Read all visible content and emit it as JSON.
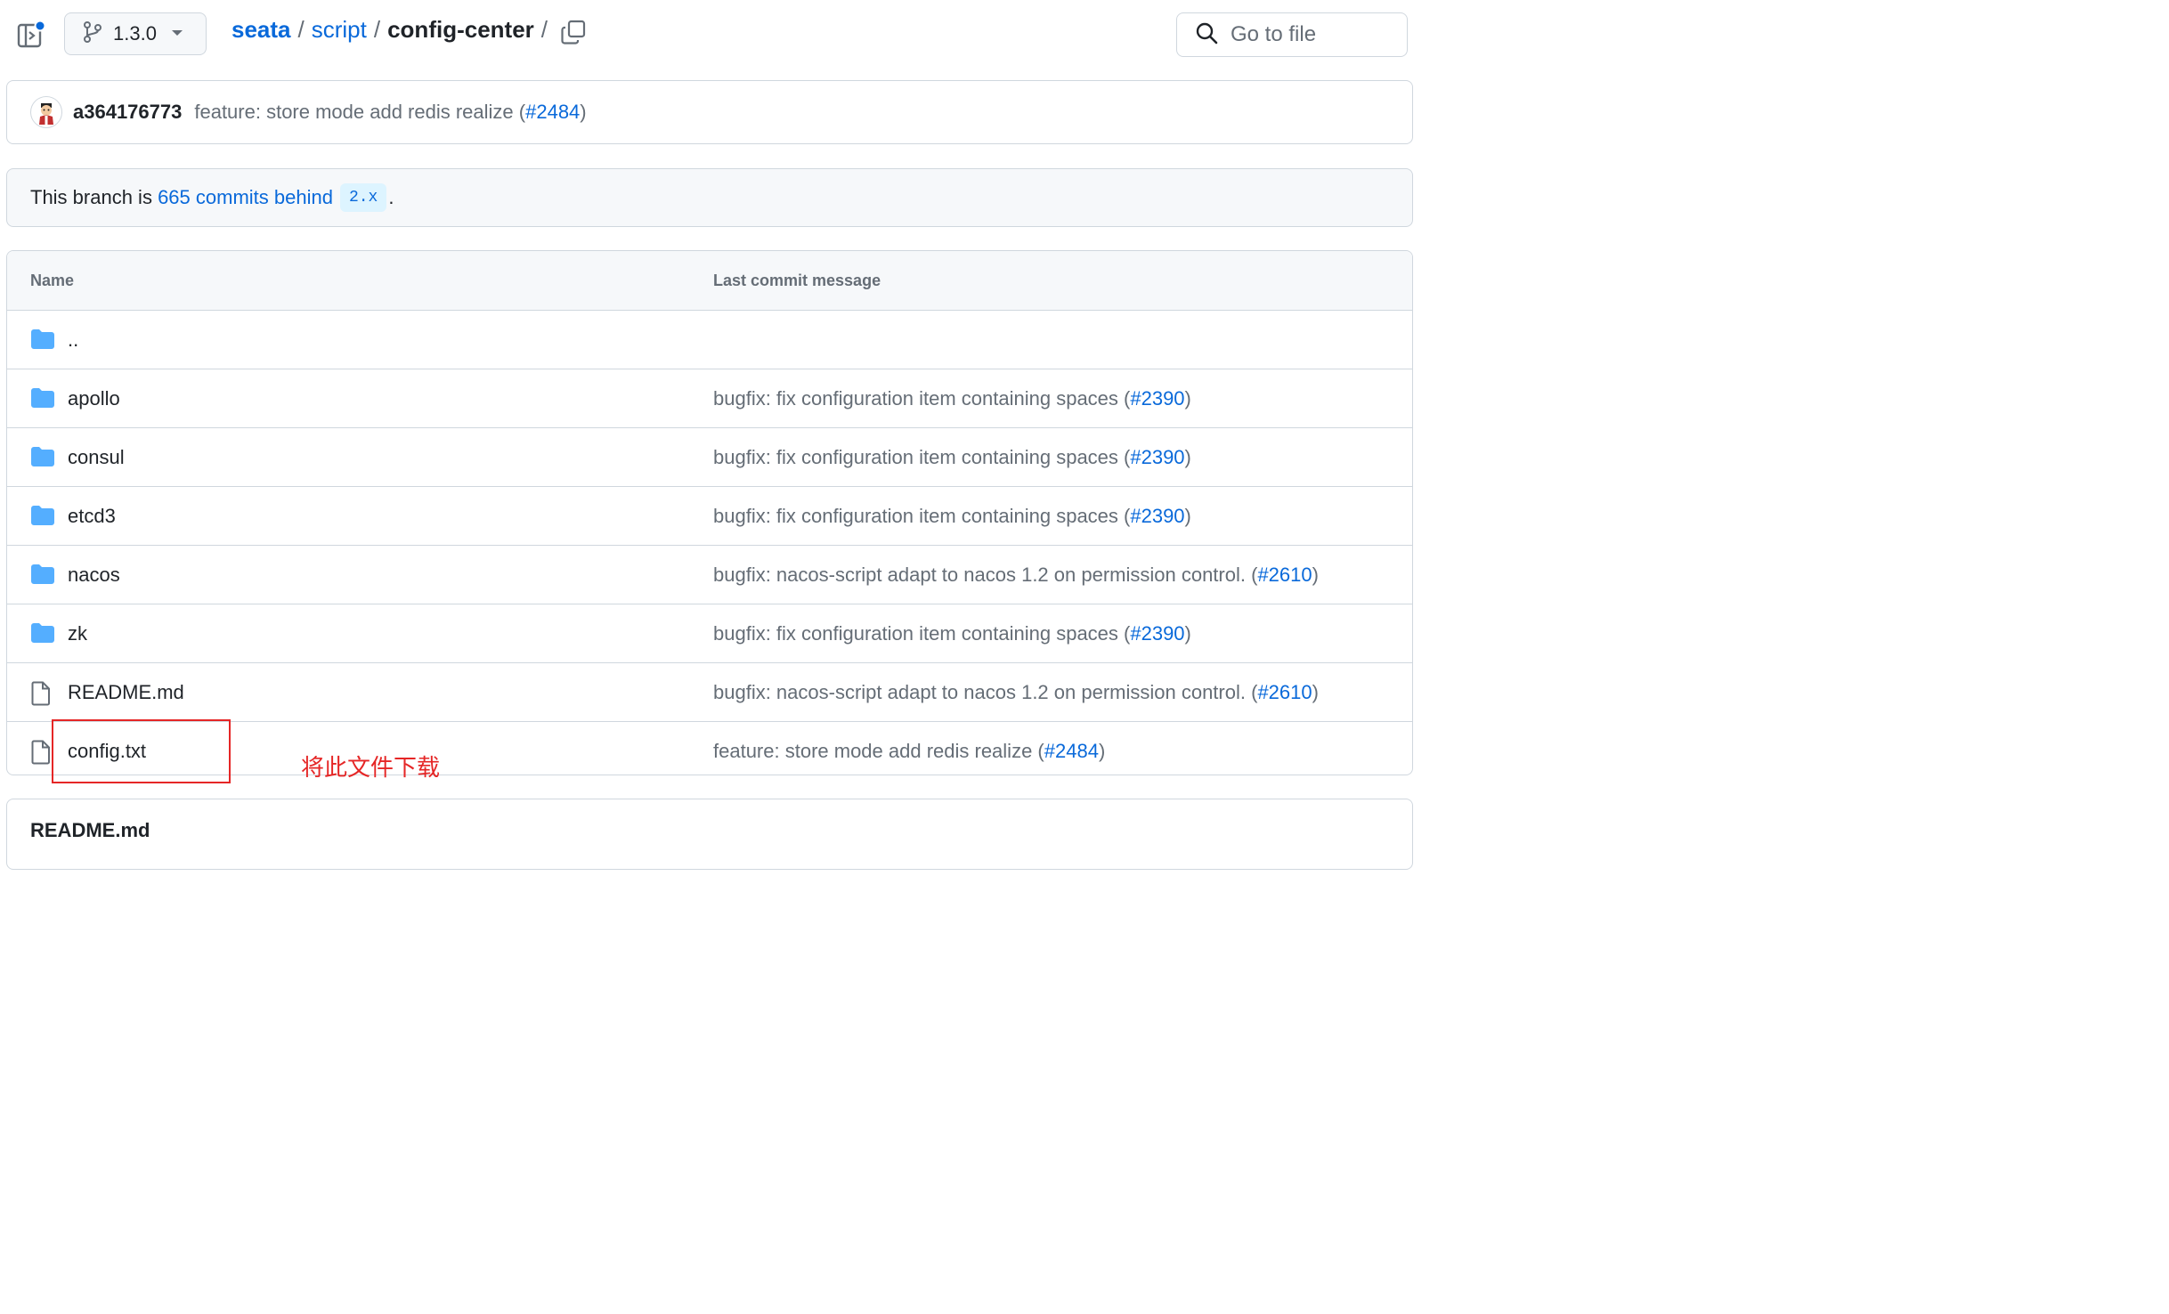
{
  "header": {
    "branch": "1.3.0",
    "breadcrumb": [
      "seata",
      "script",
      "config-center"
    ],
    "search_placeholder": "Go to file"
  },
  "commit": {
    "author": "a364176773",
    "message": "feature: store mode add redis realize (",
    "pr": "#2484",
    "close": ")"
  },
  "branch_status": {
    "prefix": "This branch is ",
    "link": "665 commits behind",
    "base": "2.x",
    "suffix": "."
  },
  "table": {
    "col_name": "Name",
    "col_msg": "Last commit message",
    "rows": [
      {
        "name": "..",
        "type": "dir",
        "msg": "",
        "pr": ""
      },
      {
        "name": "apollo",
        "type": "dir",
        "msg": "bugfix: fix configuration item containing spaces (",
        "pr": "#2390"
      },
      {
        "name": "consul",
        "type": "dir",
        "msg": "bugfix: fix configuration item containing spaces (",
        "pr": "#2390"
      },
      {
        "name": "etcd3",
        "type": "dir",
        "msg": "bugfix: fix configuration item containing spaces (",
        "pr": "#2390"
      },
      {
        "name": "nacos",
        "type": "dir",
        "msg": "bugfix: nacos-script adapt to nacos 1.2 on permission control. (",
        "pr": "#2610"
      },
      {
        "name": "zk",
        "type": "dir",
        "msg": "bugfix: fix configuration item containing spaces (",
        "pr": "#2390"
      },
      {
        "name": "README.md",
        "type": "file",
        "msg": "bugfix: nacos-script adapt to nacos 1.2 on permission control. (",
        "pr": "#2610"
      },
      {
        "name": "config.txt",
        "type": "file",
        "msg": "feature: store mode add redis realize (",
        "pr": "#2484"
      }
    ]
  },
  "readme": {
    "title": "README.md"
  },
  "annotation": {
    "text": "将此文件下载"
  },
  "colors": {
    "link": "#0969da",
    "folder": "#54aeff",
    "annotation": "#e52626"
  }
}
